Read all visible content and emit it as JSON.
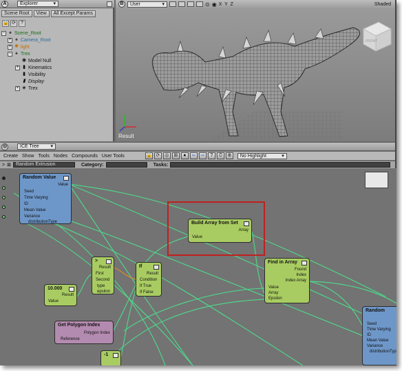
{
  "explorer": {
    "badge": "A",
    "title": "Explorer",
    "scene_root_btn": "Scene Root",
    "view_btn": "View",
    "filter_btn": "All Except Params",
    "tree": [
      {
        "label": "Scene_Root",
        "color": "#1a6a1a"
      },
      {
        "label": "Camera_Root",
        "color": "#2a6a9a"
      },
      {
        "label": "light",
        "color": "#c07000"
      },
      {
        "label": "Trex",
        "color": "#1a6a1a"
      },
      {
        "label": "Model Null",
        "color": "#111111"
      },
      {
        "label": "Kinematics",
        "color": "#111111"
      },
      {
        "label": "Visibility",
        "color": "#111111"
      },
      {
        "label": "Display",
        "color": "#111111"
      },
      {
        "label": "Trex",
        "color": "#111111"
      }
    ]
  },
  "viewport": {
    "badge": "B",
    "camera": "User",
    "axes": "X Y Z",
    "mode": "Shaded",
    "status": "Result",
    "cube_label": "FRONT"
  },
  "ice": {
    "title": "ICE Tree",
    "menu": [
      "Create",
      "Show",
      "Tools",
      "Nodes",
      "Compounds",
      "User Tools"
    ],
    "path_label": "Random Extrusion",
    "category_label": "Category:",
    "tasks_label": "Tasks:",
    "highlight_select": "No Highlight",
    "nodes": {
      "random_value": {
        "title": "Random Value",
        "out": "Value",
        "ports": [
          "Seed",
          "Time Varying",
          "ID",
          "Mean Value",
          "Variance",
          "distributionType"
        ]
      },
      "gt": {
        "title": ">",
        "out": "Result",
        "ports": [
          "First",
          "Second",
          "type",
          "epsilon"
        ]
      },
      "if": {
        "title": "If",
        "out": "Result",
        "ports": [
          "Condition",
          "If True",
          "If False"
        ]
      },
      "build_array": {
        "title": "Build Array from Set",
        "out": "Array",
        "in": "Value"
      },
      "find_array": {
        "title": "Find in Array",
        "outs": [
          "Found",
          "Index",
          "Index Array"
        ],
        "ports": [
          "Value",
          "Array",
          "Epsilon"
        ]
      },
      "scalar": {
        "title": "10.000",
        "out": "Result",
        "in": "Value"
      },
      "get_poly": {
        "title": "Get Polygon Index",
        "out": "Polygon Index",
        "in": "Reference"
      },
      "minus_one": {
        "title": "-1"
      },
      "random_right": {
        "title": "Random",
        "ports": [
          "Seed",
          "Time Varying",
          "ID",
          "Mean Value",
          "Variance",
          "distributionType"
        ]
      }
    }
  },
  "colors": {
    "node_green": "#a9cc62",
    "node_blue": "#6e97c9",
    "node_purple": "#b48bb0",
    "highlight": "#c0201e",
    "wire": "#4fd48a"
  }
}
